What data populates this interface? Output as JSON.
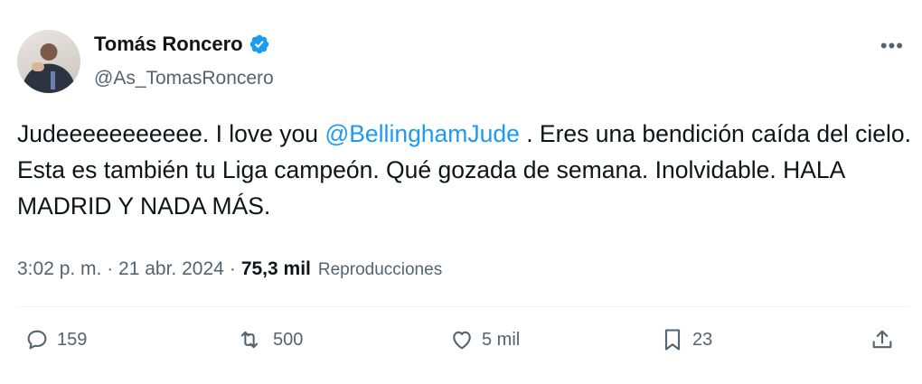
{
  "author": {
    "name": "Tomás Roncero",
    "handle": "@As_TomasRoncero",
    "verified_color": "#1d9bf0"
  },
  "tweet": {
    "text_before": "Judeeeeeeeeeee. I love you ",
    "mention": "@BellinghamJude",
    "text_after": " . Eres una bendición caída del cielo. Esta es también tu Liga campeón. Qué gozada de semana. Inolvidable. HALA MADRID Y NADA MÁS."
  },
  "meta": {
    "timestamp": "3:02 p. m. · 21 abr. 2024",
    "separator": "·",
    "views_count": "75,3 mil",
    "views_label": "Reproducciones"
  },
  "actions": {
    "replies": "159",
    "retweets": "500",
    "likes": "5 mil",
    "bookmarks": "23"
  },
  "icons": {
    "more": "more-options-icon",
    "reply": "reply-icon",
    "retweet": "retweet-icon",
    "like": "heart-icon",
    "bookmark": "bookmark-icon",
    "share": "share-icon"
  },
  "colors": {
    "link": "#1d9bf0",
    "secondary_text": "#536471",
    "primary_text": "#0f1419"
  }
}
